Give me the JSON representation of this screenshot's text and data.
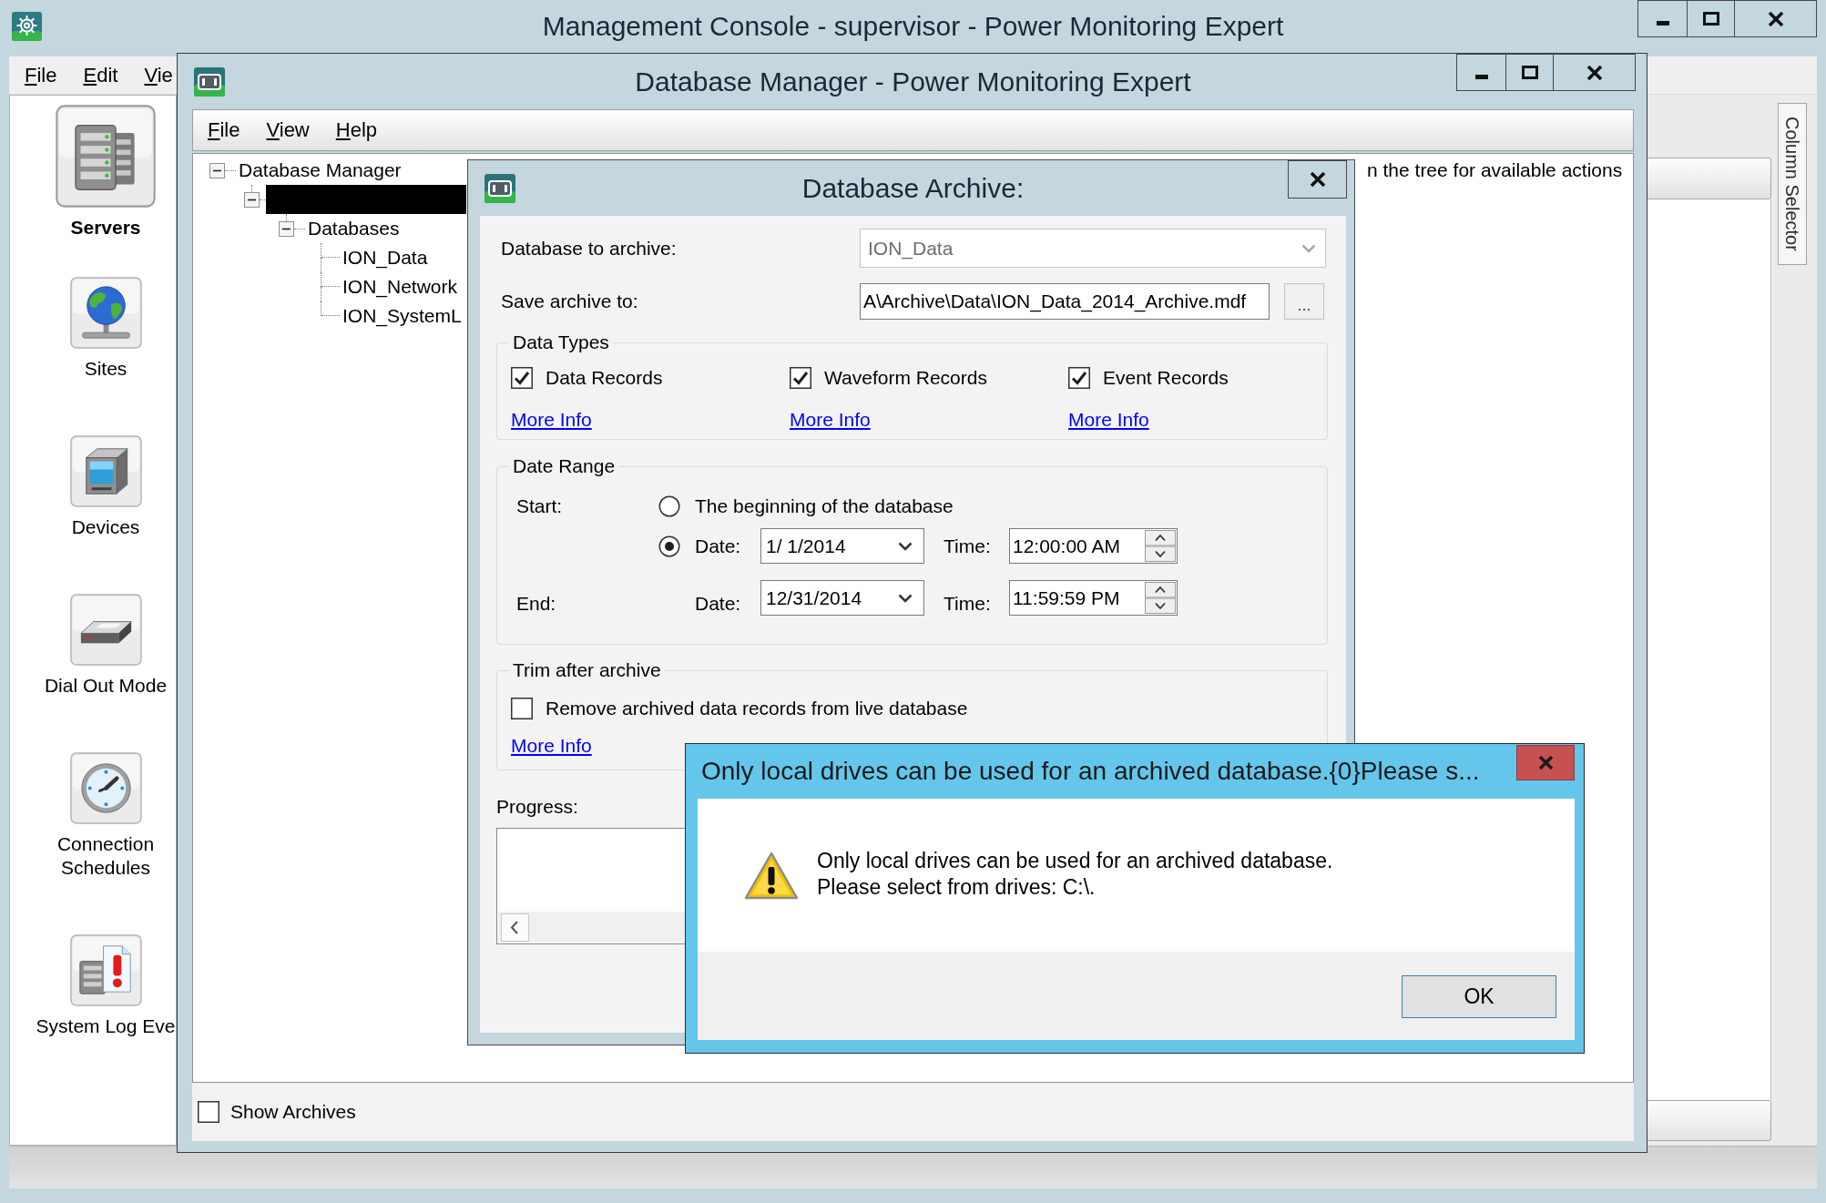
{
  "main_window": {
    "title": "Management Console - supervisor - Power Monitoring Expert",
    "menu": [
      "File",
      "Edit",
      "Vie"
    ],
    "sidebar": [
      {
        "label": "Servers",
        "selected": true
      },
      {
        "label": "Sites",
        "selected": false
      },
      {
        "label": "Devices",
        "selected": false
      },
      {
        "label": "Dial Out Mode",
        "selected": false
      },
      {
        "label": "Connection Schedules",
        "selected": false
      },
      {
        "label": "System Log Eve",
        "selected": false
      }
    ],
    "side_tab": "Column Selector"
  },
  "database_manager": {
    "title": "Database Manager - Power Monitoring Expert",
    "menu": [
      "File",
      "View",
      "Help"
    ],
    "tree": [
      {
        "label": "Database Manager",
        "redacted": false,
        "expanded": true,
        "children": [
          {
            "redacted": true,
            "expanded": true,
            "children": [
              {
                "label": "Databases",
                "redacted": false,
                "expanded": true,
                "children": [
                  {
                    "label": "ION_Data",
                    "redacted": false
                  },
                  {
                    "label": "ION_Network",
                    "redacted": false
                  },
                  {
                    "label": "ION_SystemL",
                    "redacted": false
                  }
                ]
              }
            ]
          }
        ]
      }
    ],
    "details_text": "n the tree for available actions",
    "show_archives": {
      "label": "Show Archives",
      "checked": false
    }
  },
  "archive_dialog": {
    "title": "Database Archive:",
    "database": {
      "label": "Database to archive:",
      "value": "ION_Data",
      "disabled": true
    },
    "save_to": {
      "label": "Save archive to:",
      "value": "A\\Archive\\Data\\ION_Data_2014_Archive.mdf",
      "browse_button": "..."
    },
    "data_types": {
      "title": "Data Types",
      "options": [
        {
          "label": "Data Records",
          "checked": true,
          "link": "More Info"
        },
        {
          "label": "Waveform Records",
          "checked": true,
          "link": "More Info"
        },
        {
          "label": "Event Records",
          "checked": true,
          "link": "More Info"
        }
      ]
    },
    "date_range": {
      "title": "Date Range",
      "start_label": "Start:",
      "start_options": [
        {
          "kind": "plain",
          "label": "The beginning of the database",
          "selected": false
        },
        {
          "kind": "date",
          "label": "Date:",
          "selected": true,
          "date": "1/ 1/2014",
          "time_label": "Time:",
          "time": "12:00:00 AM"
        }
      ],
      "end": {
        "label": "End:",
        "date_label": "Date:",
        "date": "12/31/2014",
        "time_label": "Time:",
        "time": "11:59:59 PM"
      }
    },
    "trim": {
      "title": "Trim after archive",
      "option": {
        "label": "Remove archived data records from live database",
        "checked": false
      },
      "link": "More Info"
    },
    "progress": {
      "label": "Progress:"
    }
  },
  "message_box": {
    "title": "Only local drives can be used for an archived database.{0}Please s...",
    "lines": [
      "Only local drives can be used for an archived database.",
      "Please select from drives: C:\\."
    ],
    "button": "OK"
  }
}
